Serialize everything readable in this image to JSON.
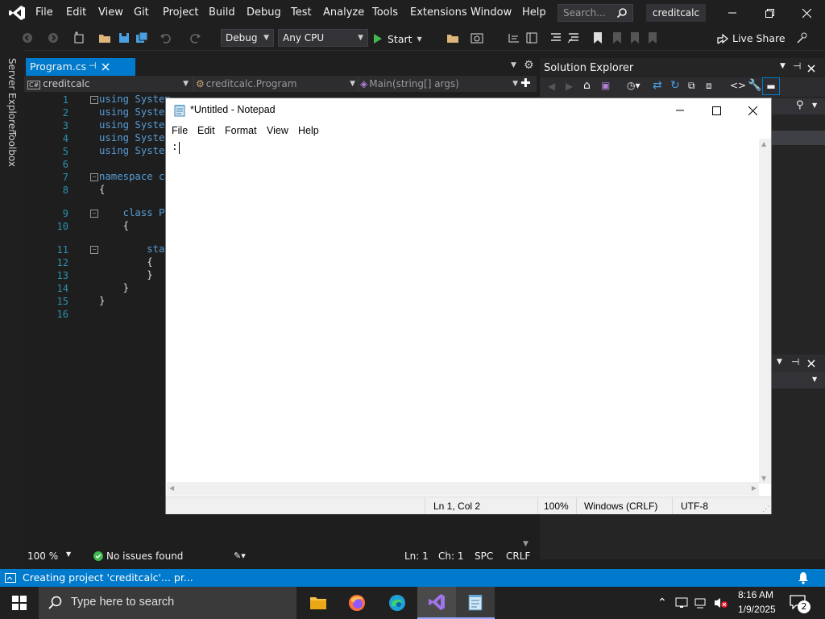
{
  "vs": {
    "menu": [
      "File",
      "Edit",
      "View",
      "Git",
      "Project",
      "Build",
      "Debug",
      "Test",
      "Analyze",
      "Tools",
      "Extensions",
      "Window",
      "Help"
    ],
    "search_placeholder": "Search...",
    "solution_name": "creditcalc",
    "toolbar": {
      "config": "Debug",
      "platform": "Any CPU",
      "start_label": "Start",
      "live_share": "Live Share"
    },
    "left_tabs": [
      "Server Explorer",
      "Toolbox"
    ],
    "doc_tab": "Program.cs",
    "nav": {
      "project": "creditcalc",
      "class": "creditcalc.Program",
      "member": "Main(string[] args)"
    },
    "editor": {
      "lines": [
        {
          "n": "1",
          "text": "using System"
        },
        {
          "n": "2",
          "text": "using System"
        },
        {
          "n": "3",
          "text": "using System"
        },
        {
          "n": "4",
          "text": "using System"
        },
        {
          "n": "5",
          "text": "using System"
        },
        {
          "n": "6",
          "text": ""
        },
        {
          "n": "7",
          "text": "namespace cr"
        },
        {
          "n": "8",
          "text": "{"
        },
        {
          "n": "9",
          "text": "    class Pr"
        },
        {
          "n": "10",
          "text": "    {"
        },
        {
          "n": "11",
          "text": "        stat"
        },
        {
          "n": "12",
          "text": "        {"
        },
        {
          "n": "13",
          "text": "        }"
        },
        {
          "n": "14",
          "text": "    }"
        },
        {
          "n": "15",
          "text": "}"
        },
        {
          "n": "16",
          "text": ""
        }
      ],
      "zoom": "100 %",
      "issues": "No issues found",
      "ln": "Ln: 1",
      "ch": "Ch: 1",
      "spc": "SPC",
      "eol": "CRLF"
    },
    "solution_explorer_title": "Solution Explorer",
    "status_message": "Creating project 'creditcalc'... pr...",
    "accent": "#007acc"
  },
  "notepad": {
    "title": "*Untitled - Notepad",
    "menu": [
      "File",
      "Edit",
      "Format",
      "View",
      "Help"
    ],
    "content": ":",
    "status": {
      "position": "Ln 1, Col 2",
      "zoom": "100%",
      "line_ending": "Windows (CRLF)",
      "encoding": "UTF-8"
    }
  },
  "taskbar": {
    "search_placeholder": "Type here to search",
    "time": "8:16 AM",
    "date": "1/9/2025",
    "notification_count": "2"
  }
}
